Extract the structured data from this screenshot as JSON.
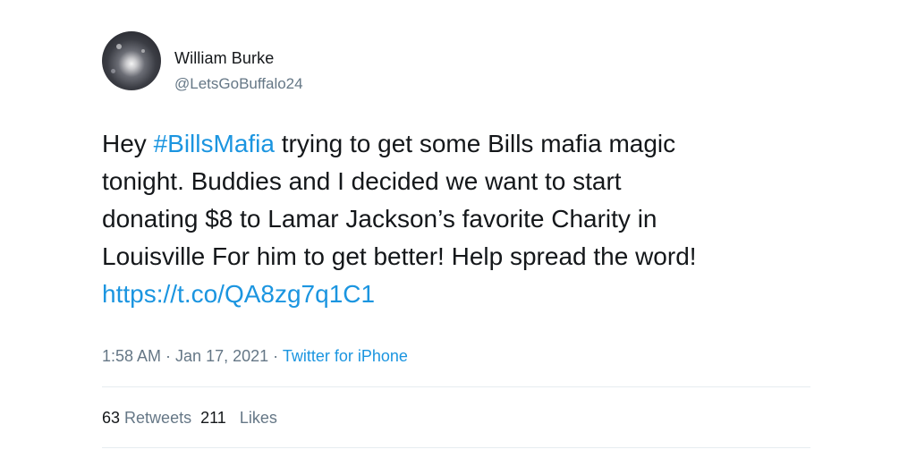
{
  "author": {
    "name": "William Burke",
    "handle": "@LetsGoBuffalo24"
  },
  "tweet": {
    "lines": [
      {
        "pre": "Hey ",
        "hashtag": "#BillsMafia",
        "post": " trying to get some Bills mafia magic"
      },
      {
        "text": "tonight. Buddies and I decided we want to start"
      },
      {
        "text": "donating $8 to Lamar Jackson’s favorite Charity in"
      },
      {
        "text": "Louisville For him to get better! Help spread the word!"
      },
      {
        "link": "https://t.co/QA8zg7q1C1"
      }
    ]
  },
  "meta": {
    "time": "1:58 AM",
    "separator": " · ",
    "date": "Jan 17, 2021",
    "source": "Twitter for iPhone"
  },
  "stats": {
    "retweets_count": "63",
    "retweets_label": "Retweets",
    "likes_count": "211",
    "likes_label": "Likes"
  },
  "colors": {
    "link": "#1b95e0",
    "secondary_text": "#657786",
    "primary_text": "#14171a"
  }
}
